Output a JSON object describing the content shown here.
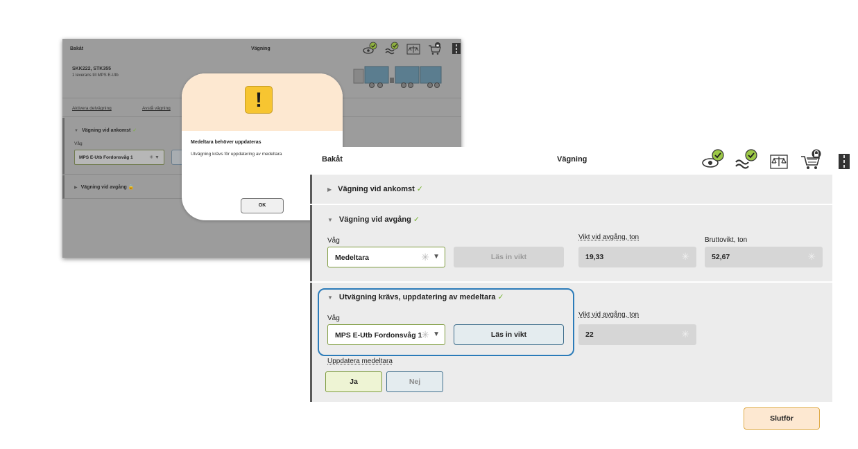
{
  "background_screen": {
    "back_label": "Bakåt",
    "title": "Vägning",
    "vehicle_ids": "SKK222, STK355",
    "delivery_info": "1 leverans till MPS E-Utb",
    "link_activate": "Aktivera delvägning",
    "link_cancel": "Avstå vägning",
    "section_arrival": "Vägning vid ankomst",
    "scale_label": "Våg",
    "scale_value": "MPS E-Utb Fordonsvåg 1",
    "section_departure": "Vägning vid avgång"
  },
  "modal": {
    "title": "Medeltara behöver uppdateras",
    "message": "Utvägning krävs för uppdatering av medeltara",
    "ok_label": "OK",
    "icon": "warning-icon"
  },
  "main": {
    "back_label": "Bakåt",
    "title": "Vägning",
    "header_icons": [
      "eye-check-icon",
      "wave-check-icon",
      "scale-icon",
      "cart-lock-icon",
      "road-icon"
    ],
    "section_arrival": {
      "title": "Vägning vid ankomst",
      "status": "✓"
    },
    "section_departure": {
      "title": "Vägning vid avgång",
      "status": "✓",
      "scale_label": "Våg",
      "scale_value": "Medeltara",
      "read_weight_label": "Läs in vikt",
      "weight_label": "Vikt vid avgång, ton",
      "weight_value": "19,33",
      "gross_label": "Bruttovikt, ton",
      "gross_value": "52,67"
    },
    "section_reweigh": {
      "title": "Utvägning krävs, uppdatering av medeltara",
      "status": "✓",
      "scale_label": "Våg",
      "scale_value": "MPS E-Utb Fordonsvåg 1",
      "read_weight_label": "Läs in vikt",
      "weight_label": "Vikt vid avgång, ton",
      "weight_value": "22",
      "update_label": "Uppdatera medeltara",
      "yes_label": "Ja",
      "no_label": "Nej"
    },
    "finish_label": "Slutför"
  },
  "colors": {
    "check": "#78b432",
    "highlight": "#2b7bb9",
    "warning": "#f7c531",
    "finish_bg": "#fde8d1"
  }
}
